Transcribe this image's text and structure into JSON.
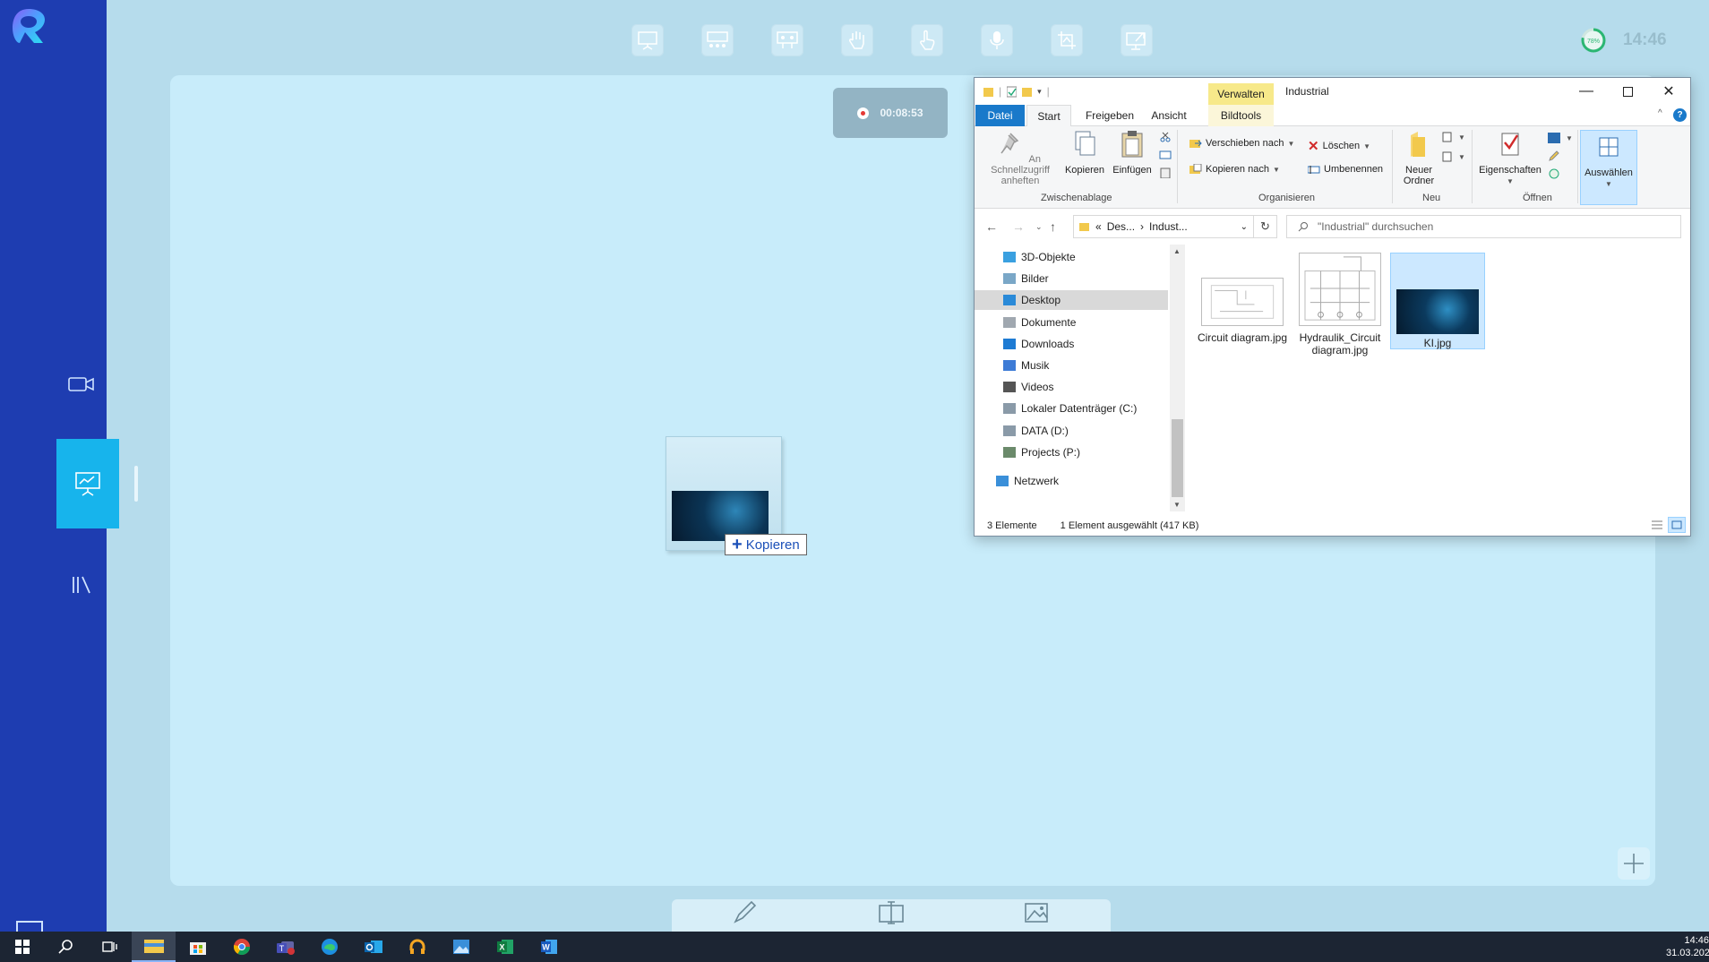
{
  "app": {
    "topbar_time": "14:46",
    "battery_percent": "78%"
  },
  "recorder": {
    "elapsed": "00:08:53"
  },
  "drag": {
    "tooltip_label": "Kopieren"
  },
  "explorer": {
    "title": "Industrial",
    "contextual_tab": "Verwalten",
    "tabs": [
      "Datei",
      "Start",
      "Freigeben",
      "Ansicht",
      "Bildtools"
    ],
    "ribbon": {
      "pin_label": "An Schnellzugriff anheften",
      "copy_label": "Kopieren",
      "paste_label": "Einfügen",
      "clipboard_group": "Zwischenablage",
      "move_to": "Verschieben nach",
      "copy_to": "Kopieren nach",
      "delete": "Löschen",
      "rename": "Umbenennen",
      "organize_group": "Organisieren",
      "new_folder": "Neuer Ordner",
      "new_group": "Neu",
      "properties": "Eigenschaften",
      "open_group": "Öffnen",
      "select": "Auswählen"
    },
    "address": {
      "crumb_1": "Des...",
      "crumb_2": "Indust..."
    },
    "search_placeholder": "\"Industrial\" durchsuchen",
    "nav": [
      {
        "label": "3D-Objekte",
        "icon": "3d-objects-icon"
      },
      {
        "label": "Bilder",
        "icon": "pictures-icon"
      },
      {
        "label": "Desktop",
        "icon": "desktop-icon",
        "selected": true
      },
      {
        "label": "Dokumente",
        "icon": "documents-icon"
      },
      {
        "label": "Downloads",
        "icon": "downloads-icon"
      },
      {
        "label": "Musik",
        "icon": "music-icon"
      },
      {
        "label": "Videos",
        "icon": "videos-icon"
      },
      {
        "label": "Lokaler Datenträger (C:)",
        "icon": "drive-icon"
      },
      {
        "label": "DATA (D:)",
        "icon": "drive-icon"
      },
      {
        "label": "Projects (P:)",
        "icon": "network-drive-icon"
      },
      {
        "label": "Netzwerk",
        "icon": "network-icon"
      }
    ],
    "files": [
      {
        "name": "Circuit diagram.jpg",
        "selected": false
      },
      {
        "name": "Hydraulik_Circuit diagram.jpg",
        "selected": false
      },
      {
        "name": "KI.jpg",
        "selected": true
      }
    ],
    "status": {
      "count": "3 Elemente",
      "selection": "1 Element ausgewählt (417 KB)"
    }
  },
  "taskbar": {
    "time": "14:46",
    "date": "31.03.202",
    "apps": [
      "start-icon",
      "search-icon",
      "task-view-icon",
      "file-explorer-icon",
      "store-icon",
      "chrome-icon",
      "teams-icon",
      "edge-icon",
      "outlook-icon",
      "headphones-app-icon",
      "photos-icon",
      "excel-icon",
      "word-icon"
    ]
  },
  "colors": {
    "rail": "#1e3db1",
    "rail_active": "#17b4ec",
    "board": "#c8ecfa",
    "background": "#b6dcec",
    "explorer_accent": "#1979ca"
  }
}
